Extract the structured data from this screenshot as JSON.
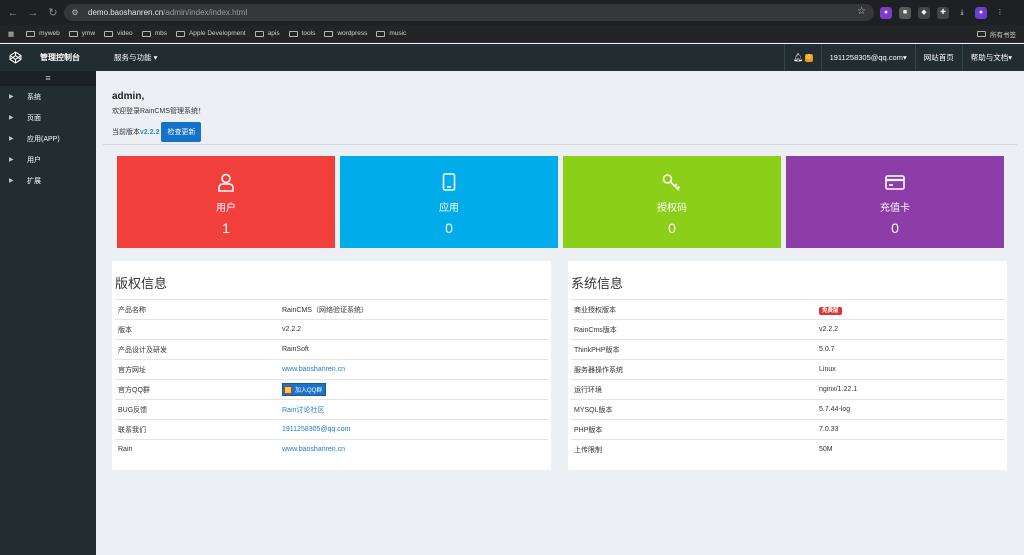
{
  "browser": {
    "url_host": "demo.baoshanren.cn",
    "url_path": "/admin/index/index.html",
    "bookmarks": [
      "myweb",
      "ymw",
      "video",
      "mbs",
      "Apple Development",
      "apis",
      "tools",
      "wordpress",
      "music"
    ],
    "all_bookmarks": "所有书签"
  },
  "header": {
    "brand": "管理控制台",
    "services_menu": "服务与功能",
    "notification_count": "0",
    "user_email": "1911258305@qq.com",
    "site_home": "网站首页",
    "help_docs": "帮助与文档"
  },
  "sidebar": {
    "items": [
      {
        "label": "系统"
      },
      {
        "label": "页面"
      },
      {
        "label": "应用(APP)"
      },
      {
        "label": "用户"
      },
      {
        "label": "扩展"
      }
    ]
  },
  "welcome": {
    "name": "admin,",
    "message": "欢迎登录RainCMS管理系统！",
    "version_label": "当前版本",
    "version": "v2.2.2",
    "check_update": "检查更新"
  },
  "tiles": [
    {
      "label": "用户",
      "value": "1",
      "color": "#f1403c",
      "icon": "user-icon"
    },
    {
      "label": "应用",
      "value": "0",
      "color": "#00acea",
      "icon": "tablet-icon"
    },
    {
      "label": "授权码",
      "value": "0",
      "color": "#8ccf19",
      "icon": "key-icon"
    },
    {
      "label": "充值卡",
      "value": "0",
      "color": "#8c3da8",
      "icon": "credit-card-icon"
    }
  ],
  "copyright": {
    "title": "版权信息",
    "rows": [
      {
        "key": "产品名称",
        "value": "RainCMS（网络验证系统）"
      },
      {
        "key": "版本",
        "value": "v2.2.2"
      },
      {
        "key": "产品设计及研发",
        "value": "RainSoft"
      },
      {
        "key": "官方网址",
        "value": "www.baoshanren.cn"
      },
      {
        "key": "官方QQ群",
        "value": "加入QQ群"
      },
      {
        "key": "BUG反馈",
        "value": "Rain讨论社区"
      },
      {
        "key": "联系我们",
        "value": "1911258305@qq.com"
      },
      {
        "key": "Rain",
        "value": "www.baoshanren.cn"
      }
    ]
  },
  "sysinfo": {
    "title": "系统信息",
    "rows": [
      {
        "key": "商业授权版本",
        "value": "免费版"
      },
      {
        "key": "RainCms版本",
        "value": "v2.2.2"
      },
      {
        "key": "ThinkPHP版本",
        "value": "5.0.7"
      },
      {
        "key": "服务器操作系统",
        "value": "Linux"
      },
      {
        "key": "运行环境",
        "value": "nginx/1.22.1"
      },
      {
        "key": "MYSQL版本",
        "value": "5.7.44-log"
      },
      {
        "key": "PHP版本",
        "value": "7.0.33"
      },
      {
        "key": "上传限制",
        "value": "50M"
      }
    ]
  }
}
